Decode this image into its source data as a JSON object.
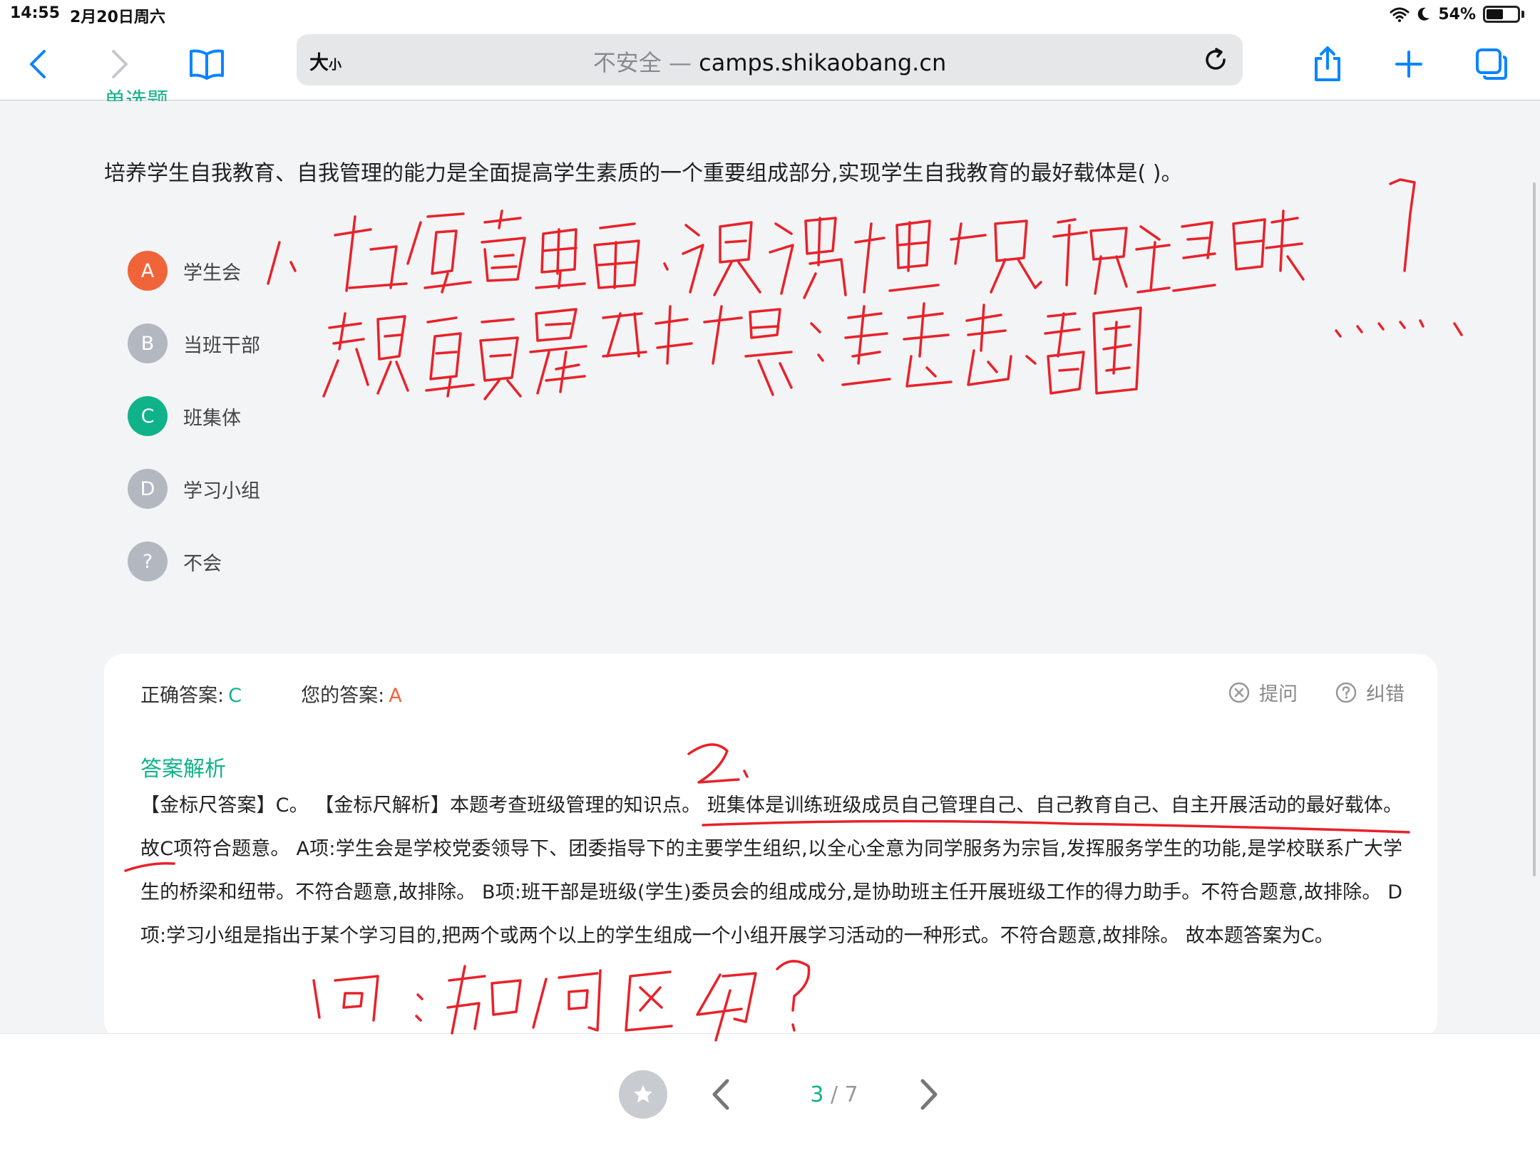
{
  "status_bar": {
    "time": "14:55",
    "date": "2月20日周六",
    "battery": "54%",
    "battery_level": 0.54
  },
  "browser": {
    "aa_big": "大",
    "aa_small": "小",
    "insecure": "不安全",
    "separator": " — ",
    "domain": "camps.shikaobang.cn"
  },
  "question": {
    "type_label": "单选题",
    "text": "培养学生自我教育、自我管理的能力是全面提高学生素质的一个重要组成部分,实现学生自我教育的最好载体是( )。",
    "options": [
      {
        "letter": "A",
        "label": "学生会",
        "color": "#f0643a"
      },
      {
        "letter": "B",
        "label": "当班干部",
        "color": "#b3b8c0"
      },
      {
        "letter": "C",
        "label": "班集体",
        "color": "#10b28a"
      },
      {
        "letter": "D",
        "label": "学习小组",
        "color": "#b3b8c0"
      },
      {
        "letter": "?",
        "label": "不会",
        "color": "#b3b8c0"
      }
    ]
  },
  "answer": {
    "correct_label": "正确答案:",
    "correct_value": "C",
    "yours_label": "您的答案:",
    "yours_value": "A",
    "ask_label": "提问",
    "correct_error_label": "纠错",
    "analysis_title": "答案解析",
    "analysis_text": "【金标尺答案】C。 【金标尺解析】本题考查班级管理的知识点。 班集体是训练班级成员自己管理自己、自己教育自己、自主开展活动的最好载体。故C项符合题意。 A项:学生会是学校党委领导下、团委指导下的主要学生组织,以全心全意为同学服务为宗旨,发挥服务学生的功能,是学校联系广大学生的桥梁和纽带。不符合题意,故排除。 B项:班干部是班级(学生)委员会的组成成分,是协助班主任开展班级工作的得力助手。不符合题意,故排除。 D项:学习小组是指出于某个学习目的,把两个或两个以上的学生组成一个小组开展学习活动的一种形式。不符合题意,故排除。 故本题答案为C。"
  },
  "pagination": {
    "current": "3",
    "total": " / 7"
  },
  "colors": {
    "accent": "#10b28a",
    "wrong": "#f0643a",
    "ink": "#e8222a"
  }
}
